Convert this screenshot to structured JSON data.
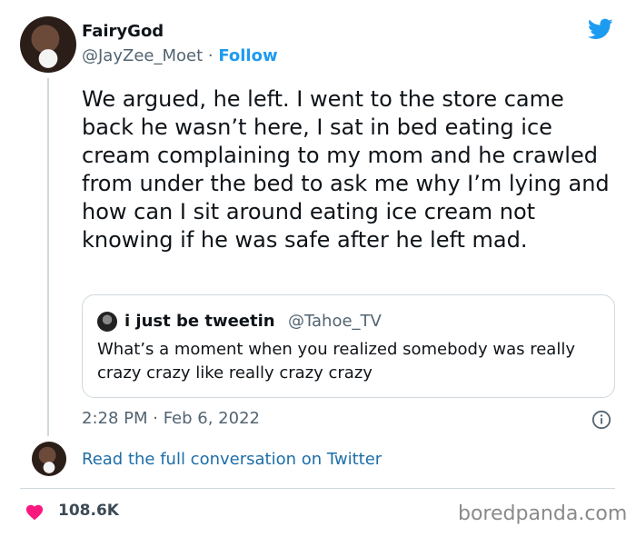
{
  "tweet": {
    "author_name": "FairyGod",
    "author_handle": "@JayZee_Moet",
    "separator": " · ",
    "follow_label": "Follow",
    "text": "We argued, he left. I went to the store came back he wasn’t here, I sat in bed eating ice cream complaining to my mom and he crawled from under the bed to ask me why I’m lying and how can I sit around eating ice cream not knowing if he was safe after he left mad.",
    "timestamp": "2:28 PM · Feb 6, 2022"
  },
  "quote": {
    "author_name": "i just be tweetin",
    "author_handle": "@Tahoe_TV",
    "text": "What’s a moment when you realized somebody was really crazy crazy like really crazy crazy"
  },
  "footer": {
    "read_link": "Read the full conversation on Twitter",
    "likes": "108.6K",
    "watermark": "boredpanda.com"
  },
  "icons": {
    "brand": "twitter-bird-icon",
    "info": "info-icon",
    "like": "heart-icon"
  },
  "colors": {
    "accent": "#1d9bf0",
    "heart": "#f91880",
    "muted": "#536471"
  }
}
